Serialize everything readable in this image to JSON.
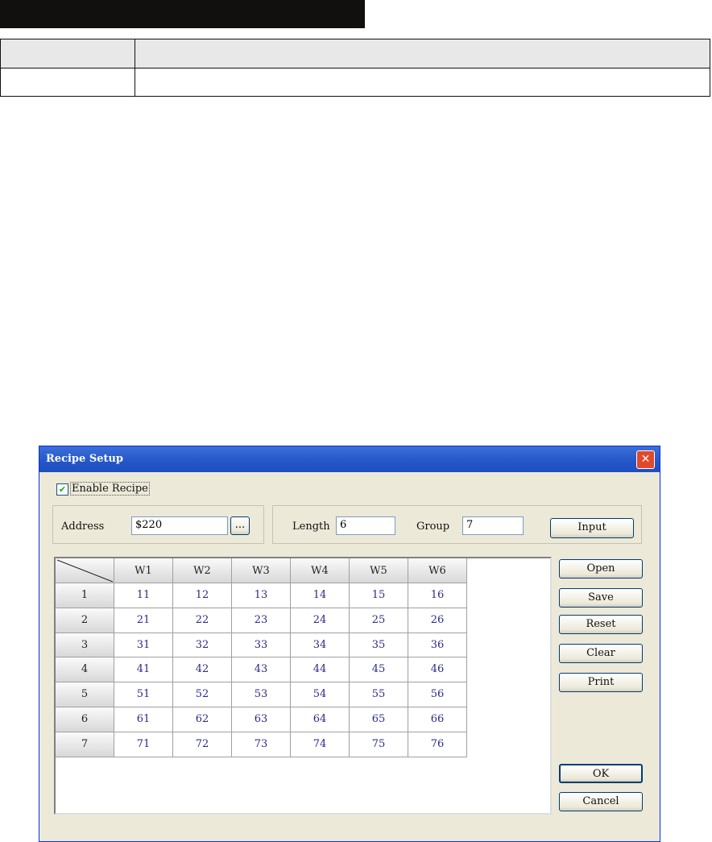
{
  "dialog": {
    "title": "Recipe Setup",
    "enable_label": "Enable Recipe",
    "enabled": true,
    "address_label": "Address",
    "address_value": "$220",
    "browse_label": "...",
    "length_label": "Length",
    "length_value": "6",
    "group_label": "Group",
    "group_value": "7",
    "input_label": "Input"
  },
  "grid": {
    "columns": [
      "W1",
      "W2",
      "W3",
      "W4",
      "W5",
      "W6"
    ],
    "rows": [
      {
        "label": "1",
        "values": [
          "11",
          "12",
          "13",
          "14",
          "15",
          "16"
        ]
      },
      {
        "label": "2",
        "values": [
          "21",
          "22",
          "23",
          "24",
          "25",
          "26"
        ]
      },
      {
        "label": "3",
        "values": [
          "31",
          "32",
          "33",
          "34",
          "35",
          "36"
        ]
      },
      {
        "label": "4",
        "values": [
          "41",
          "42",
          "43",
          "44",
          "45",
          "46"
        ]
      },
      {
        "label": "5",
        "values": [
          "51",
          "52",
          "53",
          "54",
          "55",
          "56"
        ]
      },
      {
        "label": "6",
        "values": [
          "61",
          "62",
          "63",
          "64",
          "65",
          "66"
        ]
      },
      {
        "label": "7",
        "values": [
          "71",
          "72",
          "73",
          "74",
          "75",
          "76"
        ]
      }
    ]
  },
  "buttons": {
    "open": "Open",
    "save": "Save",
    "reset": "Reset",
    "clear": "Clear",
    "print": "Print",
    "ok": "OK",
    "cancel": "Cancel"
  }
}
